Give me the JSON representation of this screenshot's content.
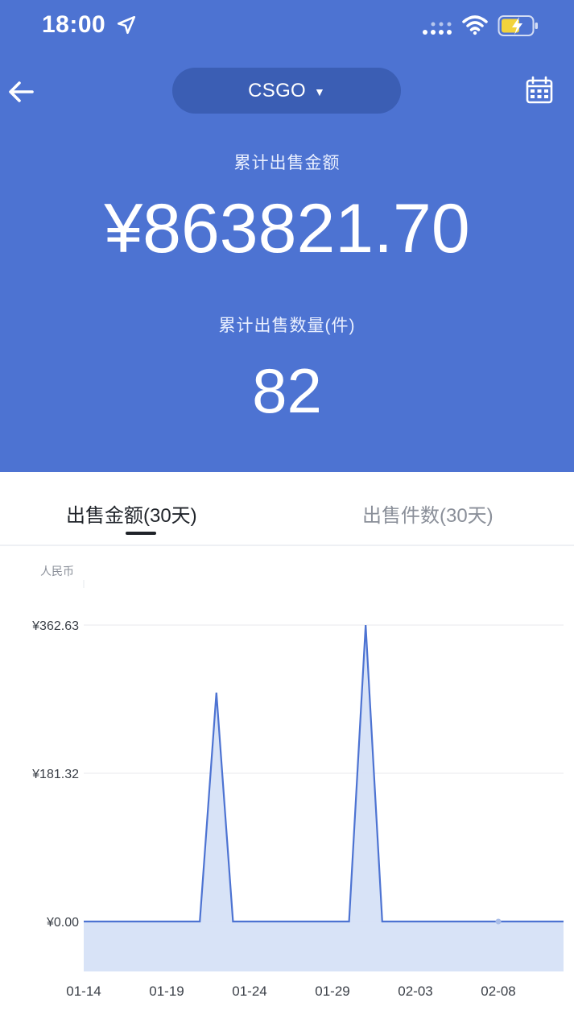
{
  "status_bar": {
    "time": "18:00"
  },
  "header": {
    "game": "CSGO"
  },
  "summary": {
    "amount_label": "累计出售金额",
    "amount_value": "¥863821.70",
    "count_label": "累计出售数量(件)",
    "count_value": "82"
  },
  "tabs": [
    {
      "label": "出售金额(30天)",
      "active": true
    },
    {
      "label": "出售件数(30天)",
      "active": false
    }
  ],
  "colors": {
    "brand": "#4d73d2",
    "line": "#4d73d2",
    "area": "#d6e2f7"
  },
  "chart_data": {
    "type": "area",
    "ylabel": "人民币",
    "y_ticks": [
      "¥362.63",
      "¥181.32",
      "¥0.00"
    ],
    "ylim": [
      0,
      362.63
    ],
    "x_tick_labels": [
      "01-14",
      "01-19",
      "01-24",
      "01-29",
      "02-03",
      "02-08"
    ],
    "series": [
      {
        "values": [
          {
            "x": "01-14",
            "y": 0
          },
          {
            "x": "01-21",
            "y": 0
          },
          {
            "x": "01-22",
            "y": 280
          },
          {
            "x": "01-23",
            "y": 0
          },
          {
            "x": "01-30",
            "y": 0
          },
          {
            "x": "01-31",
            "y": 362.63
          },
          {
            "x": "02-01",
            "y": 0
          },
          {
            "x": "02-12",
            "y": 0
          }
        ]
      }
    ]
  }
}
